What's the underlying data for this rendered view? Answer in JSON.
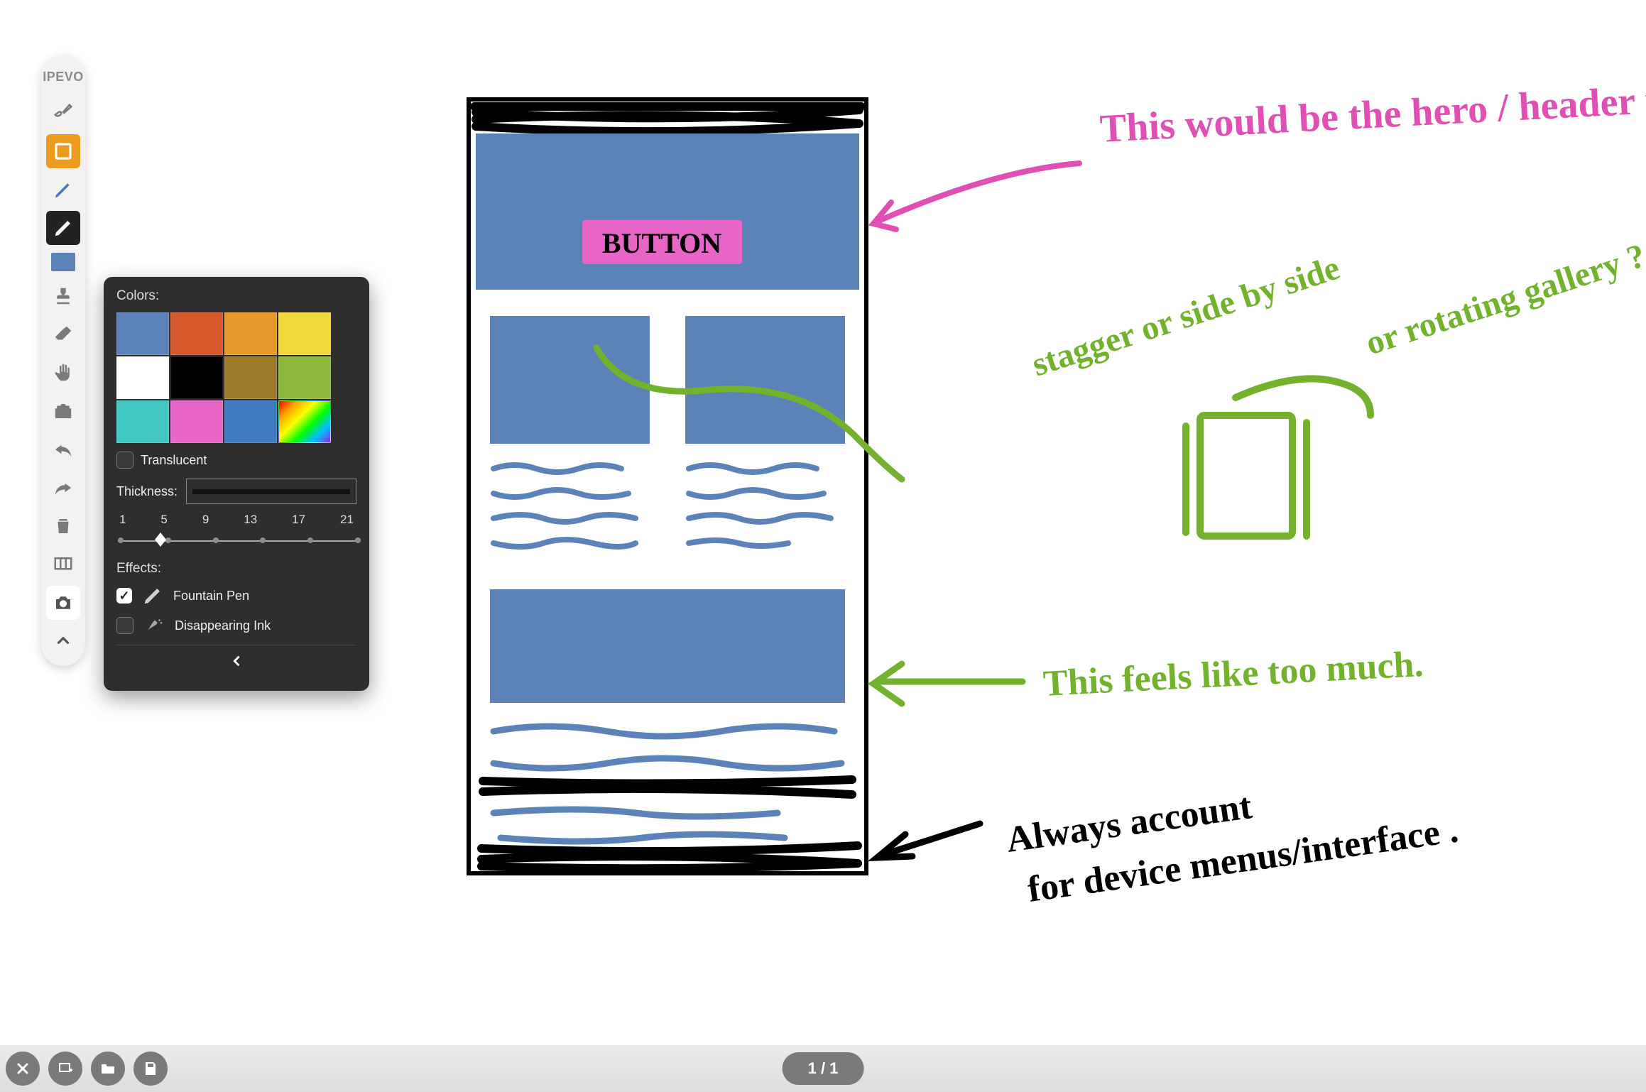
{
  "app": {
    "brand": "IPEVO"
  },
  "toolbar": {
    "tools": [
      {
        "id": "brush",
        "active": false
      },
      {
        "id": "shapes",
        "active": "orange"
      },
      {
        "id": "pen",
        "active": false
      },
      {
        "id": "pencil",
        "active": "dark"
      },
      {
        "id": "current-color"
      },
      {
        "id": "stamp"
      },
      {
        "id": "eraser"
      },
      {
        "id": "hand"
      },
      {
        "id": "toolbox"
      },
      {
        "id": "undo"
      },
      {
        "id": "redo"
      },
      {
        "id": "trash"
      },
      {
        "id": "board"
      },
      {
        "id": "camera"
      }
    ],
    "current_color": "#5c83b8"
  },
  "popover": {
    "colors_label": "Colors:",
    "swatches": [
      "#5c83b8",
      "#d6572a",
      "#e79a2c",
      "#f2d93b",
      "#ffffff",
      "#000000",
      "#9b7a2b",
      "#8cb83c",
      "#3fc7c0",
      "#e766c8",
      "#3f7cc0",
      "rainbow"
    ],
    "translucent_label": "Translucent",
    "translucent_checked": false,
    "thickness_label": "Thickness:",
    "thickness_ticks": [
      "1",
      "5",
      "9",
      "13",
      "17",
      "21"
    ],
    "thickness_value": 5,
    "effects_label": "Effects:",
    "effects": [
      {
        "id": "fountain",
        "label": "Fountain Pen",
        "checked": true
      },
      {
        "id": "disappearing",
        "label": "Disappearing Ink",
        "checked": false
      }
    ]
  },
  "canvas": {
    "wireframe": {
      "button_label": "BUTTON",
      "button_bg": "#e766c8",
      "block_color": "#5c83b8",
      "outline_color": "#000000"
    },
    "annotations": {
      "hero": {
        "text": "This would be the hero / header image.",
        "color": "#e050b4"
      },
      "gallery": {
        "text1": "stagger or side by side",
        "text2": "or rotating gallery ?",
        "color": "#72b22c"
      },
      "too_much": {
        "text": "This feels like too much.",
        "color": "#72b22c"
      },
      "device": {
        "text1": "Always account",
        "text2": "for device menus/interface .",
        "color": "#000000"
      }
    }
  },
  "bottombar": {
    "page_indicator": "1 / 1",
    "buttons": [
      "close",
      "new-board",
      "open",
      "save"
    ]
  }
}
